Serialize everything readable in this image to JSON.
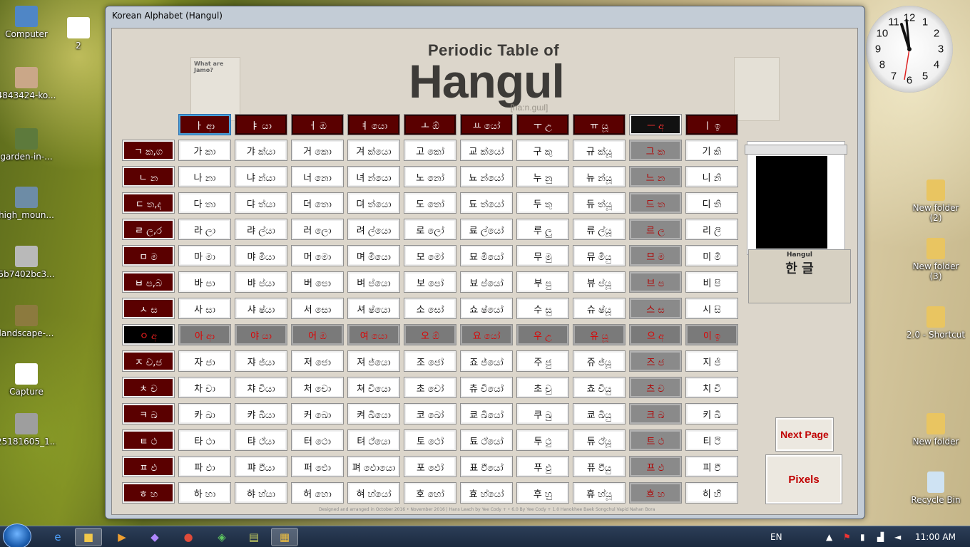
{
  "desktop": {
    "left_icons": [
      {
        "name": "computer-icon",
        "label": "Computer",
        "color": "#4f86c6"
      },
      {
        "name": "file-icon",
        "label": "2",
        "color": "#ffffff"
      },
      {
        "name": "image-icon",
        "label": "4843424-ko...",
        "color": "#caa788"
      },
      {
        "name": "image-icon",
        "label": "garden-in-...",
        "color": "#5d7a3c"
      },
      {
        "name": "image-icon",
        "label": "high_moun...",
        "color": "#6d8ca6"
      },
      {
        "name": "image-icon",
        "label": "5b7402bc3...",
        "color": "#b9b9b9"
      },
      {
        "name": "image-icon",
        "label": "landscape-...",
        "color": "#8c7a3e"
      },
      {
        "name": "image-icon",
        "label": "Capture",
        "color": "#ffffff"
      },
      {
        "name": "image-icon",
        "label": "25181605_1...",
        "color": "#9e9e9e"
      }
    ],
    "right_icons": [
      {
        "label": "New folder (2)"
      },
      {
        "label": "New folder (3)"
      },
      {
        "label": "2.0 - Shortcut"
      },
      {
        "label": "New folder"
      },
      {
        "label": "Recycle Bin"
      }
    ]
  },
  "window": {
    "title": "Korean Alphabet  (Hangul)"
  },
  "poster": {
    "subtitle": "Periodic Table of",
    "title": "Hangul",
    "pronunciation": "[ha:n.gɯl]",
    "jamo_box_title": "What are Jamo?"
  },
  "table": {
    "headers": [
      {
        "text": "ㅏ ආ",
        "style": "hdr"
      },
      {
        "text": "ㅑ යා",
        "style": "hdr"
      },
      {
        "text": "ㅓ ඔ",
        "style": "hdr"
      },
      {
        "text": "ㅕ යො",
        "style": "hdr"
      },
      {
        "text": "ㅗ ඕ",
        "style": "hdr"
      },
      {
        "text": "ㅛ යෝ",
        "style": "hdr"
      },
      {
        "text": "ㅜ උ",
        "style": "hdr"
      },
      {
        "text": "ㅠ යූ",
        "style": "hdr"
      },
      {
        "text": "ㅡ අ",
        "style": "hdr-black"
      },
      {
        "text": "ㅣ ඉ",
        "style": "hdr"
      }
    ],
    "rows": [
      {
        "label": "ㄱ ක,ග",
        "style": "rowhdr",
        "cells": [
          "가 කා",
          "갸 ක්යා",
          "거 කො",
          "겨 ක්යො",
          "고 කෝ",
          "교 ක්යෝ",
          "구 කු",
          "규 ක්යූ",
          "그 ක",
          "기 කි"
        ]
      },
      {
        "label": "ㄴ න",
        "style": "rowhdr",
        "cells": [
          "나 නා",
          "냐 න්යා",
          "너 නො",
          "녀 න්යො",
          "노 නෝ",
          "뇨 න්යෝ",
          "누 නු",
          "뉴 න්යූ",
          "느 න",
          "니 නි"
        ]
      },
      {
        "label": "ㄷ ත,ද",
        "style": "rowhdr",
        "cells": [
          "다 තා",
          "댜 ත්යා",
          "더 තො",
          "뎌 ත්යො",
          "도 තෝ",
          "됴 ත්යෝ",
          "두 තු",
          "듀 ත්යූ",
          "드 ත",
          "디 ති"
        ]
      },
      {
        "label": "ㄹ ල,ර",
        "style": "rowhdr",
        "cells": [
          "라 ලා",
          "랴 ල්යා",
          "러 ලො",
          "려 ල්යො",
          "로 ලෝ",
          "료 ල්යෝ",
          "루 ලු",
          "류 ල්යූ",
          "르 ල",
          "리 ලි"
        ]
      },
      {
        "label": "ㅁ ම",
        "style": "rowhdr",
        "cells": [
          "마 මා",
          "먀 මියා",
          "머 මො",
          "며 මියො",
          "모 මෝ",
          "묘 මියෝ",
          "무 මු",
          "뮤 මියු",
          "므 ම",
          "미 මි"
        ]
      },
      {
        "label": "ㅂ ප,බ",
        "style": "rowhdr",
        "cells": [
          "바 පා",
          "뱌 ප්යා",
          "버 පො",
          "벼 ප්යො",
          "보 පෝ",
          "뵤 ප්යෝ",
          "부 පු",
          "뷰 ප්යූ",
          "브 ප",
          "비 පි"
        ]
      },
      {
        "label": "ㅅ ස",
        "style": "rowhdr",
        "cells": [
          "사 සා",
          "샤 ෂ්යා",
          "서 සො",
          "셔 ෂ්යො",
          "소 සෝ",
          "쇼 ෂ්යෝ",
          "수 සු",
          "슈 ෂ්යූ",
          "스 ස",
          "시 සි"
        ]
      },
      {
        "label": "ㅇ අ",
        "style": "rowhdr-black",
        "cells": [
          "아 ආ",
          "야 යා",
          "어 ඔ",
          "여 යො",
          "오 ඕ",
          "요 යෝ",
          "우 උ",
          "유 යූ",
          "으 අ",
          "이 ඉ"
        ]
      },
      {
        "label": "ㅈ ච,ජ",
        "style": "rowhdr",
        "cells": [
          "자 ජා",
          "쟈 ජ්යා",
          "저 ජො",
          "져 ජ්යො",
          "조 ජෝ",
          "죠 ජ්යෝ",
          "주 ජු",
          "쥬 ජ්යූ",
          "즈 ජ",
          "지 ජි"
        ]
      },
      {
        "label": "ㅊ ච",
        "style": "rowhdr",
        "cells": [
          "차 චා",
          "챠 චියා",
          "처 චො",
          "쳐 චියො",
          "초 චෝ",
          "츄 චියෝ",
          "초 චු",
          "쵸 චියු",
          "츠 ච",
          "치 චි"
        ]
      },
      {
        "label": "ㅋ ඛ",
        "style": "rowhdr",
        "cells": [
          "카 ඛා",
          "캬 ඛියා",
          "커 ඛො",
          "켜 ඛියො",
          "코 ඛෝ",
          "쿄 ඛියෝ",
          "쿠 ඛු",
          "쿄 ඛියු",
          "크 ඛ",
          "키 ඛි"
        ]
      },
      {
        "label": "ㅌ ථ",
        "style": "rowhdr",
        "cells": [
          "타 ථා",
          "탸 ථ්යා",
          "터 ථො",
          "텨 ථ්යො",
          "토 ථෝ",
          "툐 ථ්යෝ",
          "투 ථු",
          "튜 ථ්යූ",
          "트 ථ",
          "티 ථි"
        ]
      },
      {
        "label": "ㅍ ඵ",
        "style": "rowhdr",
        "cells": [
          "파 ඵා",
          "퍄 ඵියා",
          "퍼 ඵො",
          "펴 ඵොයො",
          "포 ඵෝ",
          "표 ඵියෝ",
          "푸 ඵු",
          "퓨 ඵියු",
          "프 ඵ",
          "피 ඵි"
        ]
      },
      {
        "label": "ㅎ හ",
        "style": "rowhdr",
        "cells": [
          "하 හා",
          "햐 හ්යා",
          "허 හො",
          "혀 හ්යෝ",
          "호 හෝ",
          "효 හ්යෝ",
          "후 හු",
          "휴 හ්යූ",
          "흐 හ",
          "히 හි"
        ]
      }
    ]
  },
  "preview": {
    "thumb_title": "Hangul",
    "thumb_korean": "한 글"
  },
  "buttons": {
    "next": "Next Page",
    "pixels": "Pixels"
  },
  "footer": "Designed and arranged in October 2016 • November 2016 | Hans Leach  by Yee Cody + • 6.0  By Yee Cody + 1.0 Hanokhee Baek Songchul Vapid Nahan Bora",
  "clock": {
    "numbers": [
      "12",
      "1",
      "2",
      "3",
      "4",
      "5",
      "6",
      "7",
      "8",
      "9",
      "10",
      "11"
    ]
  },
  "taskbar": {
    "lang": "EN",
    "time": "11:00 AM"
  },
  "colors": {
    "header_red": "#5a0000",
    "text_red": "#b00000"
  }
}
